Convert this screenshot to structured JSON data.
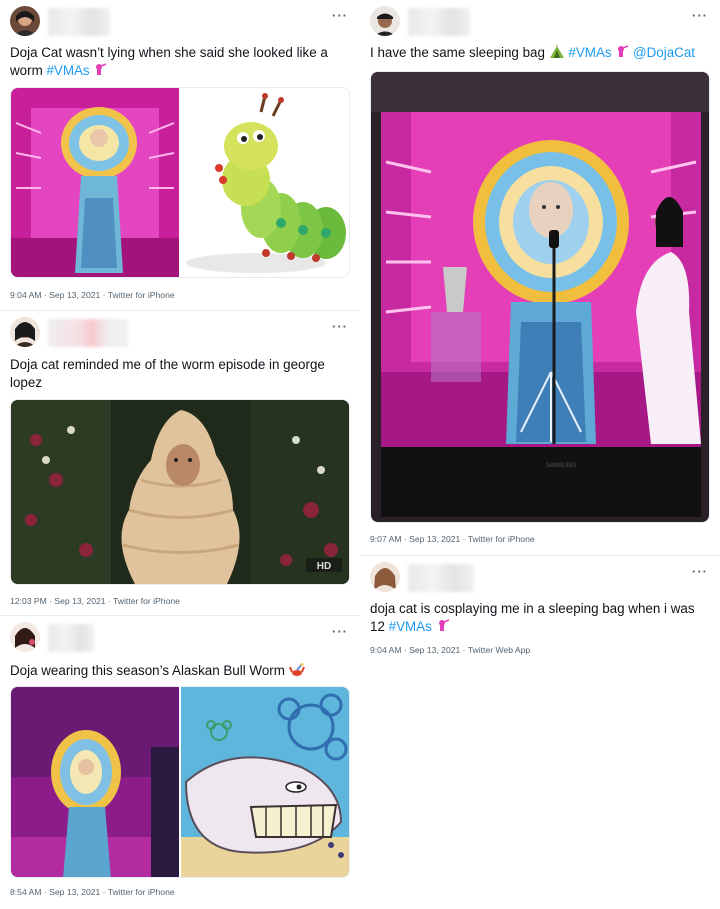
{
  "tweets": {
    "t1": {
      "text_main": "Doja Cat wasn’t lying when she said she looked like a worm ",
      "hashtag": "#VMAs",
      "meta": "9:04 AM · Sep 13, 2021 · Twitter for iPhone"
    },
    "t2": {
      "text_main": "I have the same sleeping bag ",
      "hashtag": "#VMAs",
      "mention": "@DojaCat",
      "meta": "9:07 AM · Sep 13, 2021 · Twitter for iPhone"
    },
    "t3": {
      "text_main": "Doja cat reminded me of the worm episode in george lopez",
      "meta": "12:03 PM · Sep 13, 2021 · Twitter for iPhone",
      "hd_badge": "HD"
    },
    "t4": {
      "text_main": "doja cat is cosplaying me in a sleeping bag when i was 12 ",
      "hashtag": "#VMAs",
      "meta": "9:04 AM · Sep 13, 2021 · Twitter Web App"
    },
    "t5": {
      "text_main": "Doja wearing this season’s Alaskan Bull Worm ",
      "meta": "8:54 AM · Sep 13, 2021 · Twitter for iPhone"
    }
  },
  "more_label": "···",
  "tv_brand": "SAMSUNG",
  "icons": [
    "vmas-astronaut-icon",
    "tent-icon",
    "crab-icon",
    "more-options-icon"
  ],
  "colors": {
    "link": "#1d9bf0",
    "meta": "#536471",
    "divider": "#e6ecf0",
    "stage_pink": "#e0319f"
  }
}
